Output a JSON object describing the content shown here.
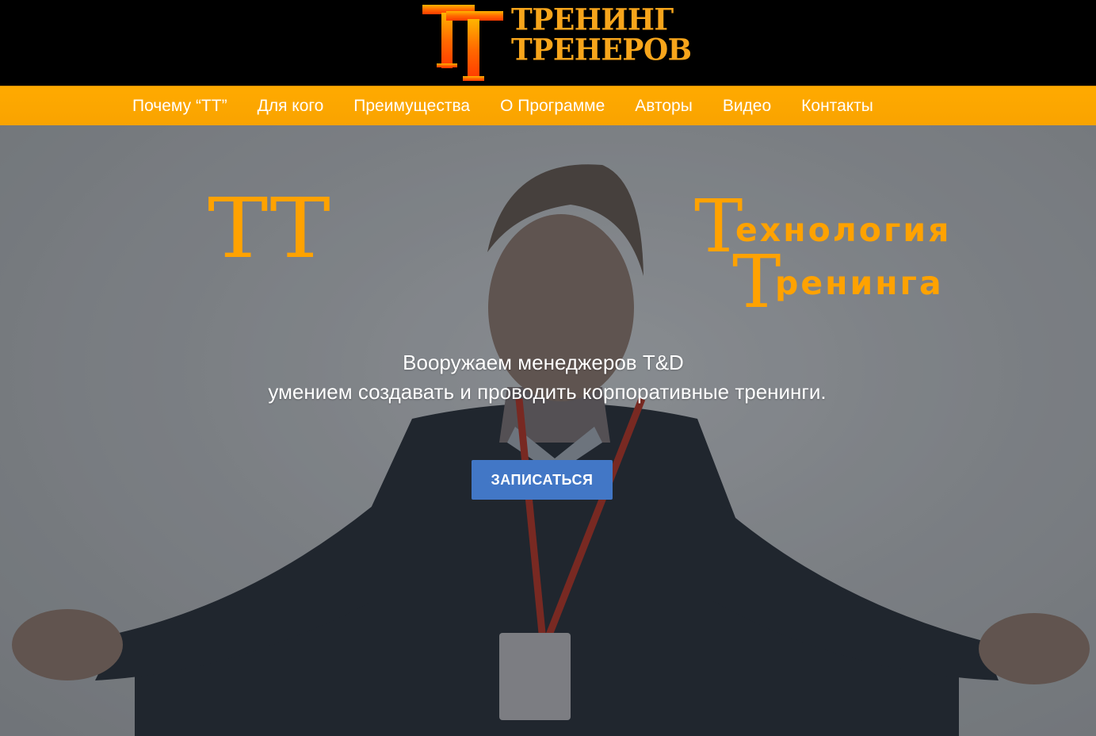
{
  "header": {
    "logo_monogram": "ТТ",
    "logo_line1": "ТРЕНИНГ",
    "logo_line2": "ТРЕНЕРОВ",
    "background": "#000000"
  },
  "nav": {
    "background": "#ffa600",
    "items": [
      {
        "label": "Почему “ТТ”"
      },
      {
        "label": "Для кого"
      },
      {
        "label": "Преимущества"
      },
      {
        "label": "О Программе"
      },
      {
        "label": "Авторы"
      },
      {
        "label": "Видео"
      },
      {
        "label": "Контакты"
      }
    ]
  },
  "hero": {
    "monogram": "ТТ",
    "tagline_line1_cap": "Т",
    "tagline_line1_rest": "ехнология",
    "tagline_line2_cap": "Т",
    "tagline_line2_rest": "ренинга",
    "subtitle_line1": "Вооружаем менеджеров T&D",
    "subtitle_line2": "умением создавать и проводить корпоративные тренинги.",
    "cta_label": "ЗАПИСАТЬСЯ",
    "accent_color": "#ffa200",
    "cta_color": "#4277c6"
  }
}
